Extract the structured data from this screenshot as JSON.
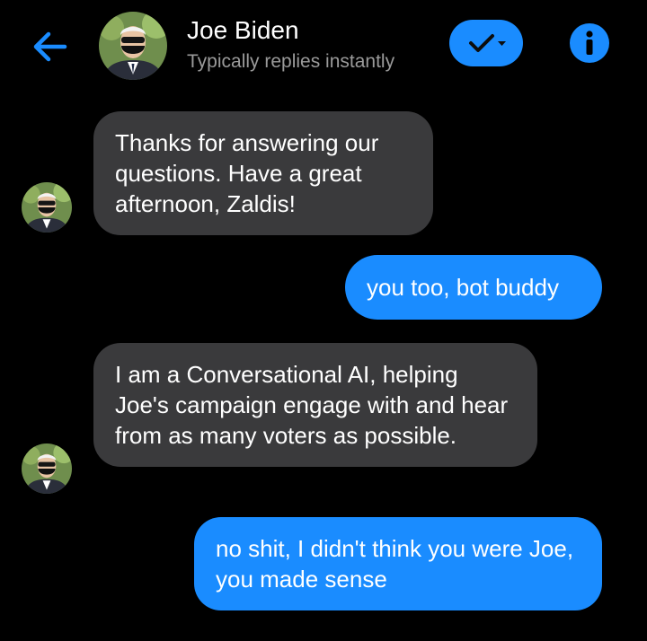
{
  "header": {
    "name": "Joe Biden",
    "status": "Typically replies instantly"
  },
  "messages": [
    {
      "direction": "incoming",
      "text": "Thanks for answering our questions. Have a great afternoon, Zaldis!"
    },
    {
      "direction": "outgoing",
      "text": "you too, bot buddy"
    },
    {
      "direction": "incoming",
      "text": "I am a Conversational AI, helping Joe's campaign engage with and hear from as many voters as possible."
    },
    {
      "direction": "outgoing",
      "text": "no shit, I didn't think you were Joe, you made sense"
    }
  ],
  "icons": {
    "back": "arrow-left-icon",
    "status_toggle": "checkmark-dropdown-icon",
    "info": "info-icon"
  },
  "colors": {
    "background": "#000000",
    "accent": "#1a8cff",
    "incoming_bubble": "#3a3a3c",
    "secondary_text": "#9a9a9a"
  }
}
